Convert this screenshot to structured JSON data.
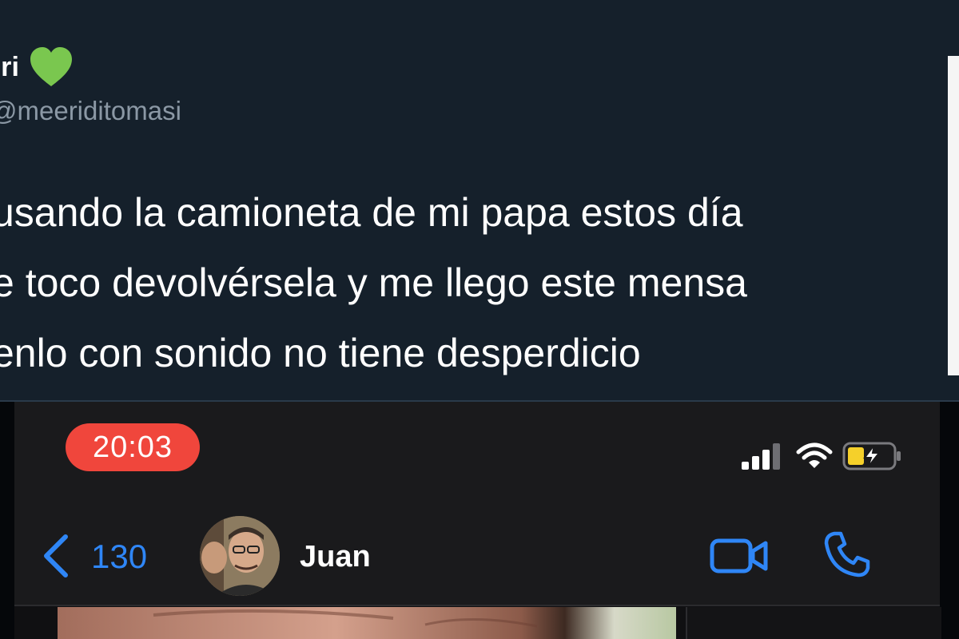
{
  "tweet": {
    "display_name": "eri",
    "handle": "meeriditomasi",
    "text_lines": [
      "usando la camioneta de mi papa estos día",
      "e toco devolvérsela y me llego este mensa",
      "enlo con sonido no tiene desperdicio"
    ],
    "heart_color": "#7ac74f"
  },
  "phone": {
    "status_time": "20:03",
    "back_count": "130",
    "contact_name": "Juan",
    "accent_color": "#2f86f6",
    "recording_pill_color": "#f0463c",
    "battery_color": "#f5d02a"
  }
}
